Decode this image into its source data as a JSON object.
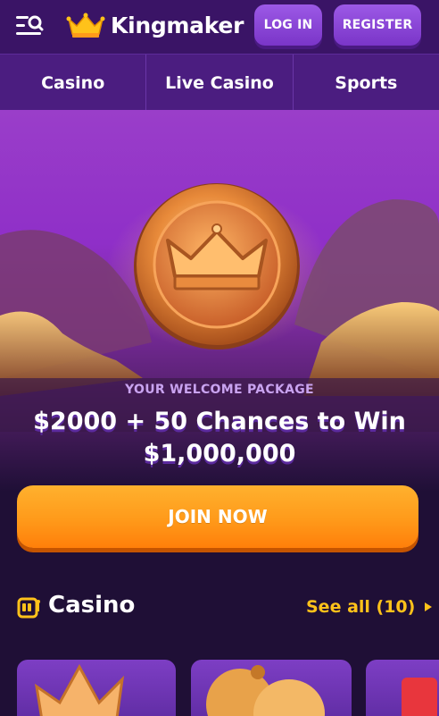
{
  "header": {
    "logo_text": "Kingmaker",
    "login_label": "LOG IN",
    "register_label": "REGISTER",
    "menu_icon": "menu-search-icon",
    "logo_icon": "crown-icon"
  },
  "nav": {
    "items": [
      {
        "label": "Casino"
      },
      {
        "label": "Live Casino"
      },
      {
        "label": "Sports"
      }
    ]
  },
  "hero": {
    "label": "YOUR WELCOME PACKAGE",
    "title_line1": "$2000 + 50 Chances to Win",
    "title_line2": "$1,000,000",
    "join_label": "JOIN NOW"
  },
  "casino_section": {
    "title": "Casino",
    "see_all": "See all (10)",
    "icon": "slot-machine-icon"
  },
  "colors": {
    "header_bg": "#3a1466",
    "nav_bg": "#4b1d80",
    "accent_gold": "#ffc21a",
    "join_orange": "#ff9a1a",
    "page_bg": "#1f0f36"
  }
}
